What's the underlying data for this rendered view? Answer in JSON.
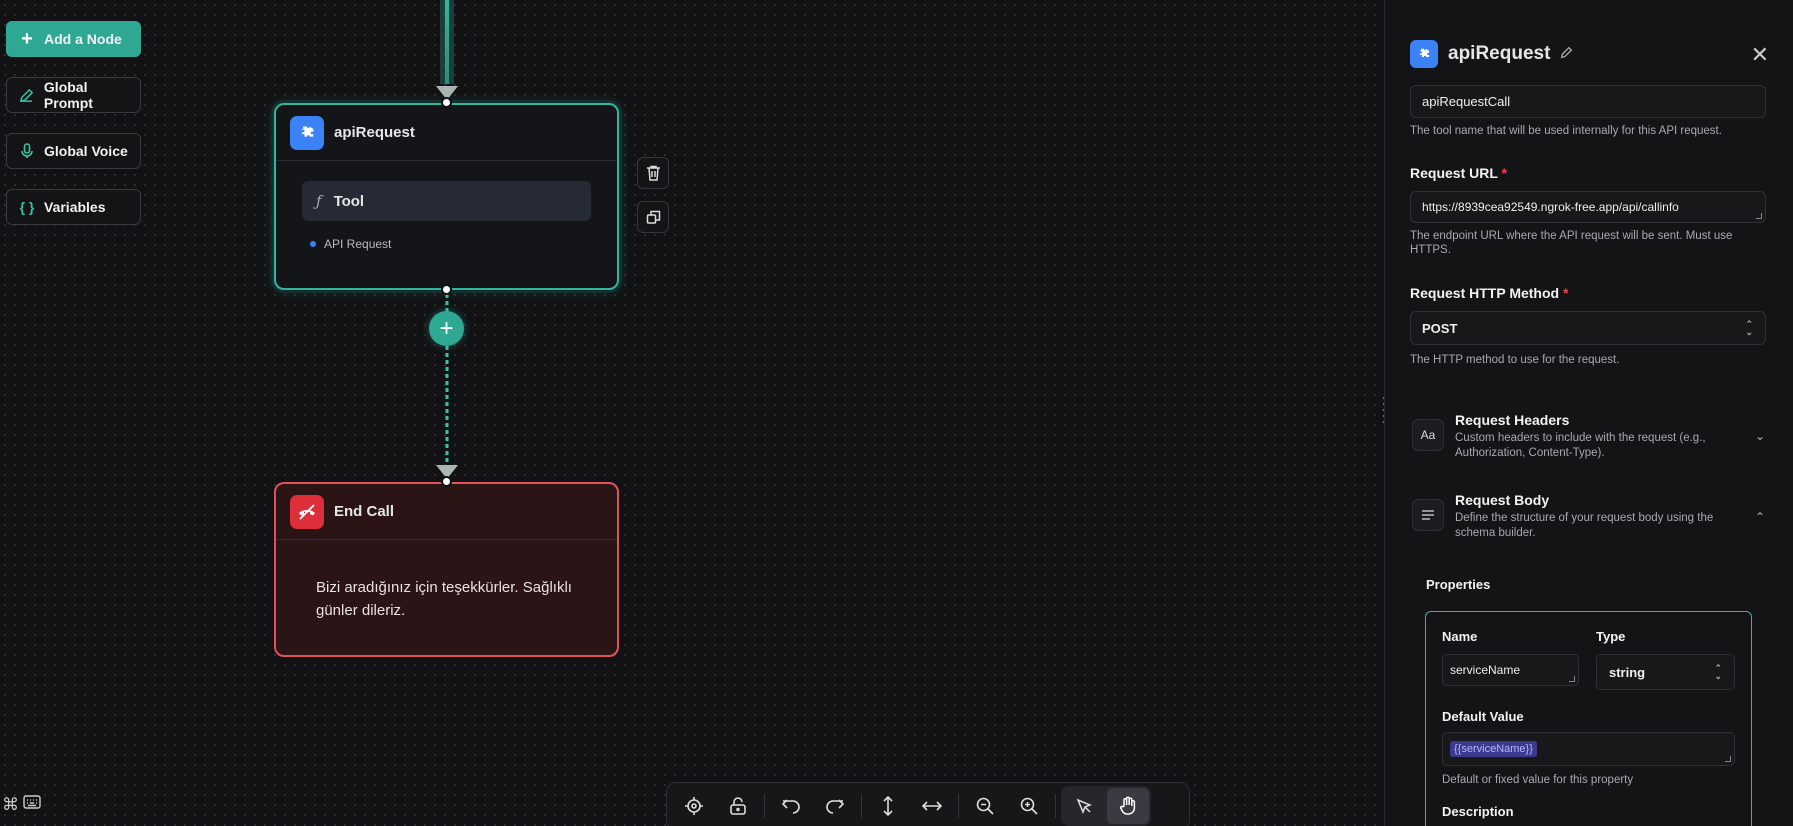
{
  "left_menu": {
    "add_node": "Add a Node",
    "global_prompt": "Global Prompt",
    "global_voice": "Global Voice",
    "variables": "Variables"
  },
  "nodes": {
    "api": {
      "title": "apiRequest",
      "tool_label": "Tool",
      "tool_symbol": "ƒ",
      "tag": "API Request"
    },
    "end": {
      "title": "End Call",
      "message": "Bizi aradığınız için teşekkürler. Sağlıklı günler dileriz."
    }
  },
  "panel": {
    "title": "apiRequest",
    "tool_name_value": "apiRequestCall",
    "tool_name_help": "The tool name that will be used internally for this API request.",
    "url_label": "Request URL",
    "url_value": "https://8939cea92549.ngrok-free.app/api/callinfo",
    "url_help": "The endpoint URL where the API request will be sent. Must use HTTPS.",
    "method_label": "Request HTTP Method",
    "method_value": "POST",
    "method_help": "The HTTP method to use for the request.",
    "headers_title": "Request Headers",
    "headers_desc": "Custom headers to include with the request (e.g., Authorization, Content-Type).",
    "headers_icon_text": "Aa",
    "body_title": "Request Body",
    "body_desc": "Define the structure of your request body using the schema builder.",
    "properties_label": "Properties",
    "prop": {
      "name_label": "Name",
      "name_value": "serviceName",
      "type_label": "Type",
      "type_value": "string",
      "default_label": "Default Value",
      "default_value": "{{serviceName}}",
      "default_help": "Default or fixed value for this property",
      "description_label": "Description"
    }
  },
  "colors": {
    "accent": "#2fa893",
    "end_red": "#e0515b",
    "api_blue": "#3b82f6"
  }
}
